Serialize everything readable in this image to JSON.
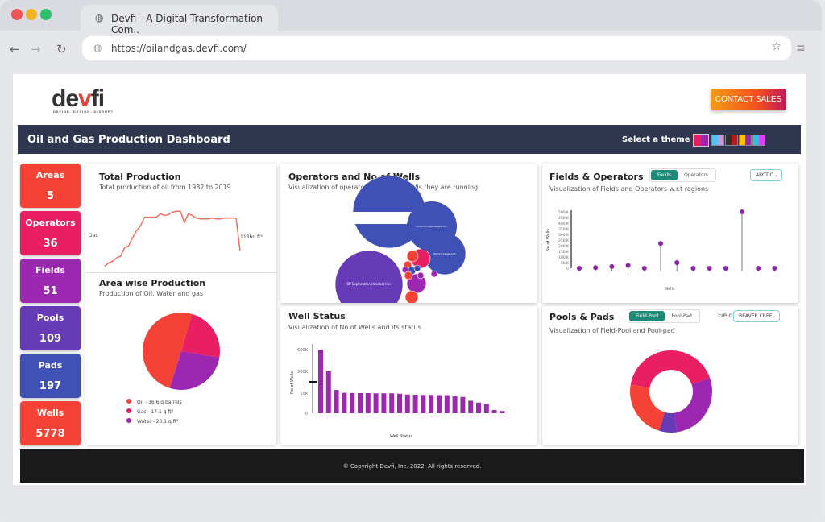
{
  "browser": {
    "tab_title": "Devfi - A Digital Transformation Com..",
    "url": "https://oilandgas.devfi.com/"
  },
  "logo": {
    "text": "devfi",
    "tagline": "DEFINE. DESIGN. DISRUPT"
  },
  "contact_label": "CONTACT SALES",
  "header": {
    "title": "Oil and Gas Production Dashboard",
    "theme_label": "Select a theme :",
    "themes": [
      [
        "#e91e63",
        "#9c27b0"
      ],
      [
        "#4fc3f7",
        "#ce93d8"
      ],
      [
        "#2f2f2f",
        "#b71c1c"
      ],
      [
        "#ffc107",
        "#9c27b0"
      ],
      [
        "#26c6da",
        "#e040fb"
      ]
    ]
  },
  "stats": [
    {
      "label": "Areas",
      "value": "5",
      "color": "#f44336"
    },
    {
      "label": "Operators",
      "value": "36",
      "color": "#e91e63"
    },
    {
      "label": "Fields",
      "value": "51",
      "color": "#9c27b0"
    },
    {
      "label": "Pools",
      "value": "109",
      "color": "#673ab7"
    },
    {
      "label": "Pads",
      "value": "197",
      "color": "#3f51b5"
    },
    {
      "label": "Wells",
      "value": "5778",
      "color": "#f44336"
    }
  ],
  "total": {
    "title": "Total Production",
    "subtitle": "Total production of oil from 1982 to 2019",
    "left_label": "Gas",
    "end_label": "113bn ft³"
  },
  "area": {
    "title": "Area wise Production",
    "subtitle": "Production of Oil, Water and gas"
  },
  "operators": {
    "title": "Operators and No of Wells",
    "subtitle": "Visualization of operators and No of wells they are running"
  },
  "well": {
    "title": "Well Status",
    "subtitle": "Visualization of No of Wells and its status"
  },
  "fields": {
    "title": "Fields & Operators",
    "subtitle": "Visualization of Fields and Operators w.r.t regions",
    "toggle": [
      "Fields",
      "Operators"
    ],
    "select": "ARCTIC"
  },
  "pools": {
    "title": "Pools & Pads",
    "subtitle": "Visualization of Field-Pool and Pool-pad",
    "toggle": [
      "Field-Pool",
      "Pool-Pad"
    ],
    "select_label": "Field",
    "select": "BEAVER CREEK"
  },
  "footer": "© Copyright Devfi, Inc. 2022. All rights reserved.",
  "chart_data": [
    {
      "type": "line",
      "chart": "total-production",
      "left_label": "Gas",
      "end_label": "113bn ft³",
      "values": [
        10,
        14,
        16,
        20,
        22,
        32,
        34,
        44,
        52,
        58,
        68,
        68,
        68,
        68,
        72,
        70,
        71,
        74,
        75,
        75,
        62,
        72,
        70,
        67,
        66,
        66,
        66,
        67,
        66,
        66,
        67,
        67,
        67,
        67,
        28
      ]
    },
    {
      "type": "pie",
      "chart": "area-wise",
      "series": [
        {
          "name": "Oil - 36.6 q barrels",
          "value": 36.6,
          "color": "#f44336"
        },
        {
          "name": "Gas - 17.1 q ft³",
          "value": 17.1,
          "color": "#e91e63"
        },
        {
          "name": "Water - 20.1 q ft³",
          "value": 20.1,
          "color": "#9c27b0"
        }
      ]
    },
    {
      "type": "scatter",
      "chart": "operators-bubbles",
      "bubbles": [
        {
          "label": "BP Exploration (Alaska) Inc.",
          "color": "#673ab7"
        },
        {
          "label": "ConocoPhillips Alaska, Inc.",
          "color": "#3f51b5"
        },
        {
          "label": "Hilcorp Alaska LLC",
          "color": "#3f51b5"
        }
      ]
    },
    {
      "type": "bar",
      "chart": "well-status",
      "ylabel": "No of Wells",
      "xlabel": "Well Status",
      "yticks": [
        "0",
        "10K",
        "300K",
        "600K"
      ],
      "values": [
        600000,
        300000,
        52000,
        14000,
        12000,
        10000,
        10000,
        9900,
        9900,
        9900,
        9700,
        9300,
        9200,
        9100,
        9100,
        9000,
        9000,
        8400,
        8100,
        6200,
        5300,
        4700,
        1600,
        1100
      ],
      "color": "#9c27b0"
    },
    {
      "type": "scatter",
      "chart": "fields-lollipop",
      "ylabel": "No of Wells",
      "xlabel": "Wells",
      "yticks": [
        "0",
        "50 K",
        "100 K",
        "150 K",
        "200 K",
        "250 K",
        "300 K",
        "350 K",
        "400 K",
        "450 K",
        "500 K"
      ],
      "ylim": [
        0,
        500000
      ],
      "values": [
        0,
        5000,
        15000,
        25000,
        0,
        220000,
        50000,
        0,
        0,
        0,
        500000,
        0,
        0
      ],
      "color": "#8e24aa"
    },
    {
      "type": "pie",
      "chart": "pools-donut",
      "series": [
        {
          "value": 42,
          "color": "#e91e63"
        },
        {
          "value": 28,
          "color": "#9c27b0"
        },
        {
          "value": 7,
          "color": "#673ab7"
        },
        {
          "value": 23,
          "color": "#f44336"
        }
      ]
    }
  ]
}
